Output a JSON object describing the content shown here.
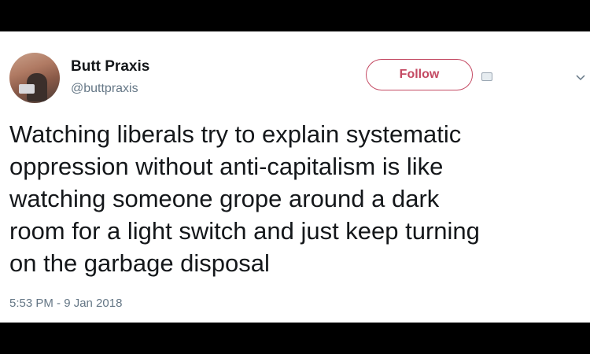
{
  "user": {
    "name": "Butt Praxis",
    "handle": "@buttpraxis"
  },
  "follow_button": {
    "label": "Follow",
    "color": "#c44a63"
  },
  "tweet": {
    "lines": [
      "Watching liberals try to explain systematic",
      "oppression without anti-capitalism is like",
      "watching someone grope around a dark",
      "room for a light switch and just keep turning",
      "on the garbage disposal"
    ]
  },
  "timestamp": "5:53 PM - 9 Jan 2018",
  "icons": {
    "avatar": "avatar",
    "follow_icon": "add-user-icon",
    "menu": "chevron-down-icon"
  }
}
